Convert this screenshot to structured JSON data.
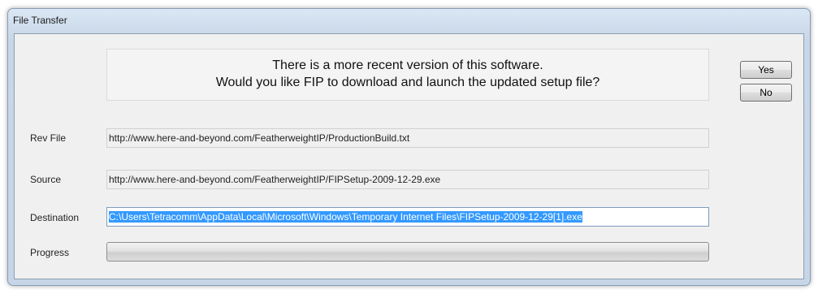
{
  "window": {
    "title": "File Transfer"
  },
  "message": {
    "line1": "There is a more recent version of this software.",
    "line2": "Would you like FIP to download and launch the updated setup file?"
  },
  "buttons": {
    "yes_label": "Yes",
    "no_label": "No"
  },
  "fields": {
    "rev_file": {
      "label": "Rev File",
      "value": "http://www.here-and-beyond.com/FeatherweightIP/ProductionBuild.txt"
    },
    "source": {
      "label": "Source",
      "value": "http://www.here-and-beyond.com/FeatherweightIP/FIPSetup-2009-12-29.exe"
    },
    "destination": {
      "label": "Destination",
      "value": "C:\\Users\\Tetracomm\\AppData\\Local\\Microsoft\\Windows\\Temporary Internet Files\\FIPSetup-2009-12-29[1].exe"
    },
    "progress": {
      "label": "Progress",
      "percent": 0
    }
  },
  "colors": {
    "selection": "#3399ff",
    "window_frame": "#c6d5e7",
    "client_bg": "#f0f0f0"
  }
}
